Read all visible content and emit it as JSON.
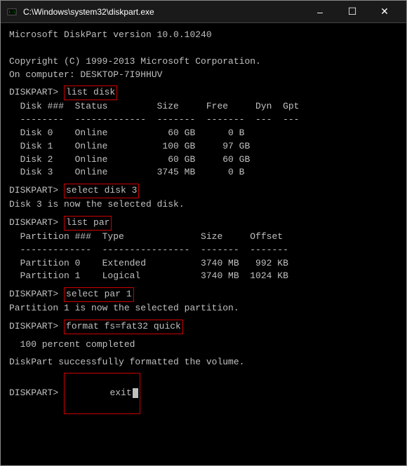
{
  "window": {
    "title": "C:\\Windows\\system32\\diskpart.exe",
    "min_label": "–",
    "max_label": "☐",
    "close_label": "✕"
  },
  "console": {
    "header_line1": "Microsoft DiskPart version 10.0.10240",
    "header_line2": "",
    "header_line3": "Copyright (C) 1999-2013 Microsoft Corporation.",
    "header_line4": "On computer: DESKTOP-7I9HHUV",
    "header_line5": "",
    "prompt1": "DISKPART> ",
    "cmd1": "list disk",
    "table_header": "  Disk ###  Status         Size     Free     Dyn  Gpt",
    "table_sep": "  --------  -------------  -------  -------  ---  ---",
    "disk0": "  Disk 0    Online           60 GB      0 B",
    "disk1": "  Disk 1    Online          100 GB     97 GB",
    "disk2": "  Disk 2    Online           60 GB     60 GB",
    "disk3": "  Disk 3    Online         3745 MB      0 B",
    "blank1": "",
    "prompt2": "DISKPART> ",
    "cmd2": "select disk 3",
    "result2": "Disk 3 is now the selected disk.",
    "blank2": "",
    "prompt3": "DISKPART> ",
    "cmd3": "list par",
    "par_header": "  Partition ###  Type              Size     Offset",
    "par_sep": "  -------------  ----------------  -------  -------",
    "par0": "  Partition 0    Extended          3740 MB   992 KB",
    "par1": "  Partition 1    Logical           3740 MB  1024 KB",
    "blank3": "",
    "prompt4": "DISKPART> ",
    "cmd4": "select par 1",
    "result4": "Partition 1 is now the selected partition.",
    "blank4": "",
    "prompt5": "DISKPART> ",
    "cmd5": "format fs=fat32 quick",
    "blank5": "",
    "result5a": "  100 percent completed",
    "blank6": "",
    "result5b": "DiskPart successfully formatted the volume.",
    "blank7": "",
    "prompt6": "DISKPART> ",
    "cmd6": "exit"
  }
}
